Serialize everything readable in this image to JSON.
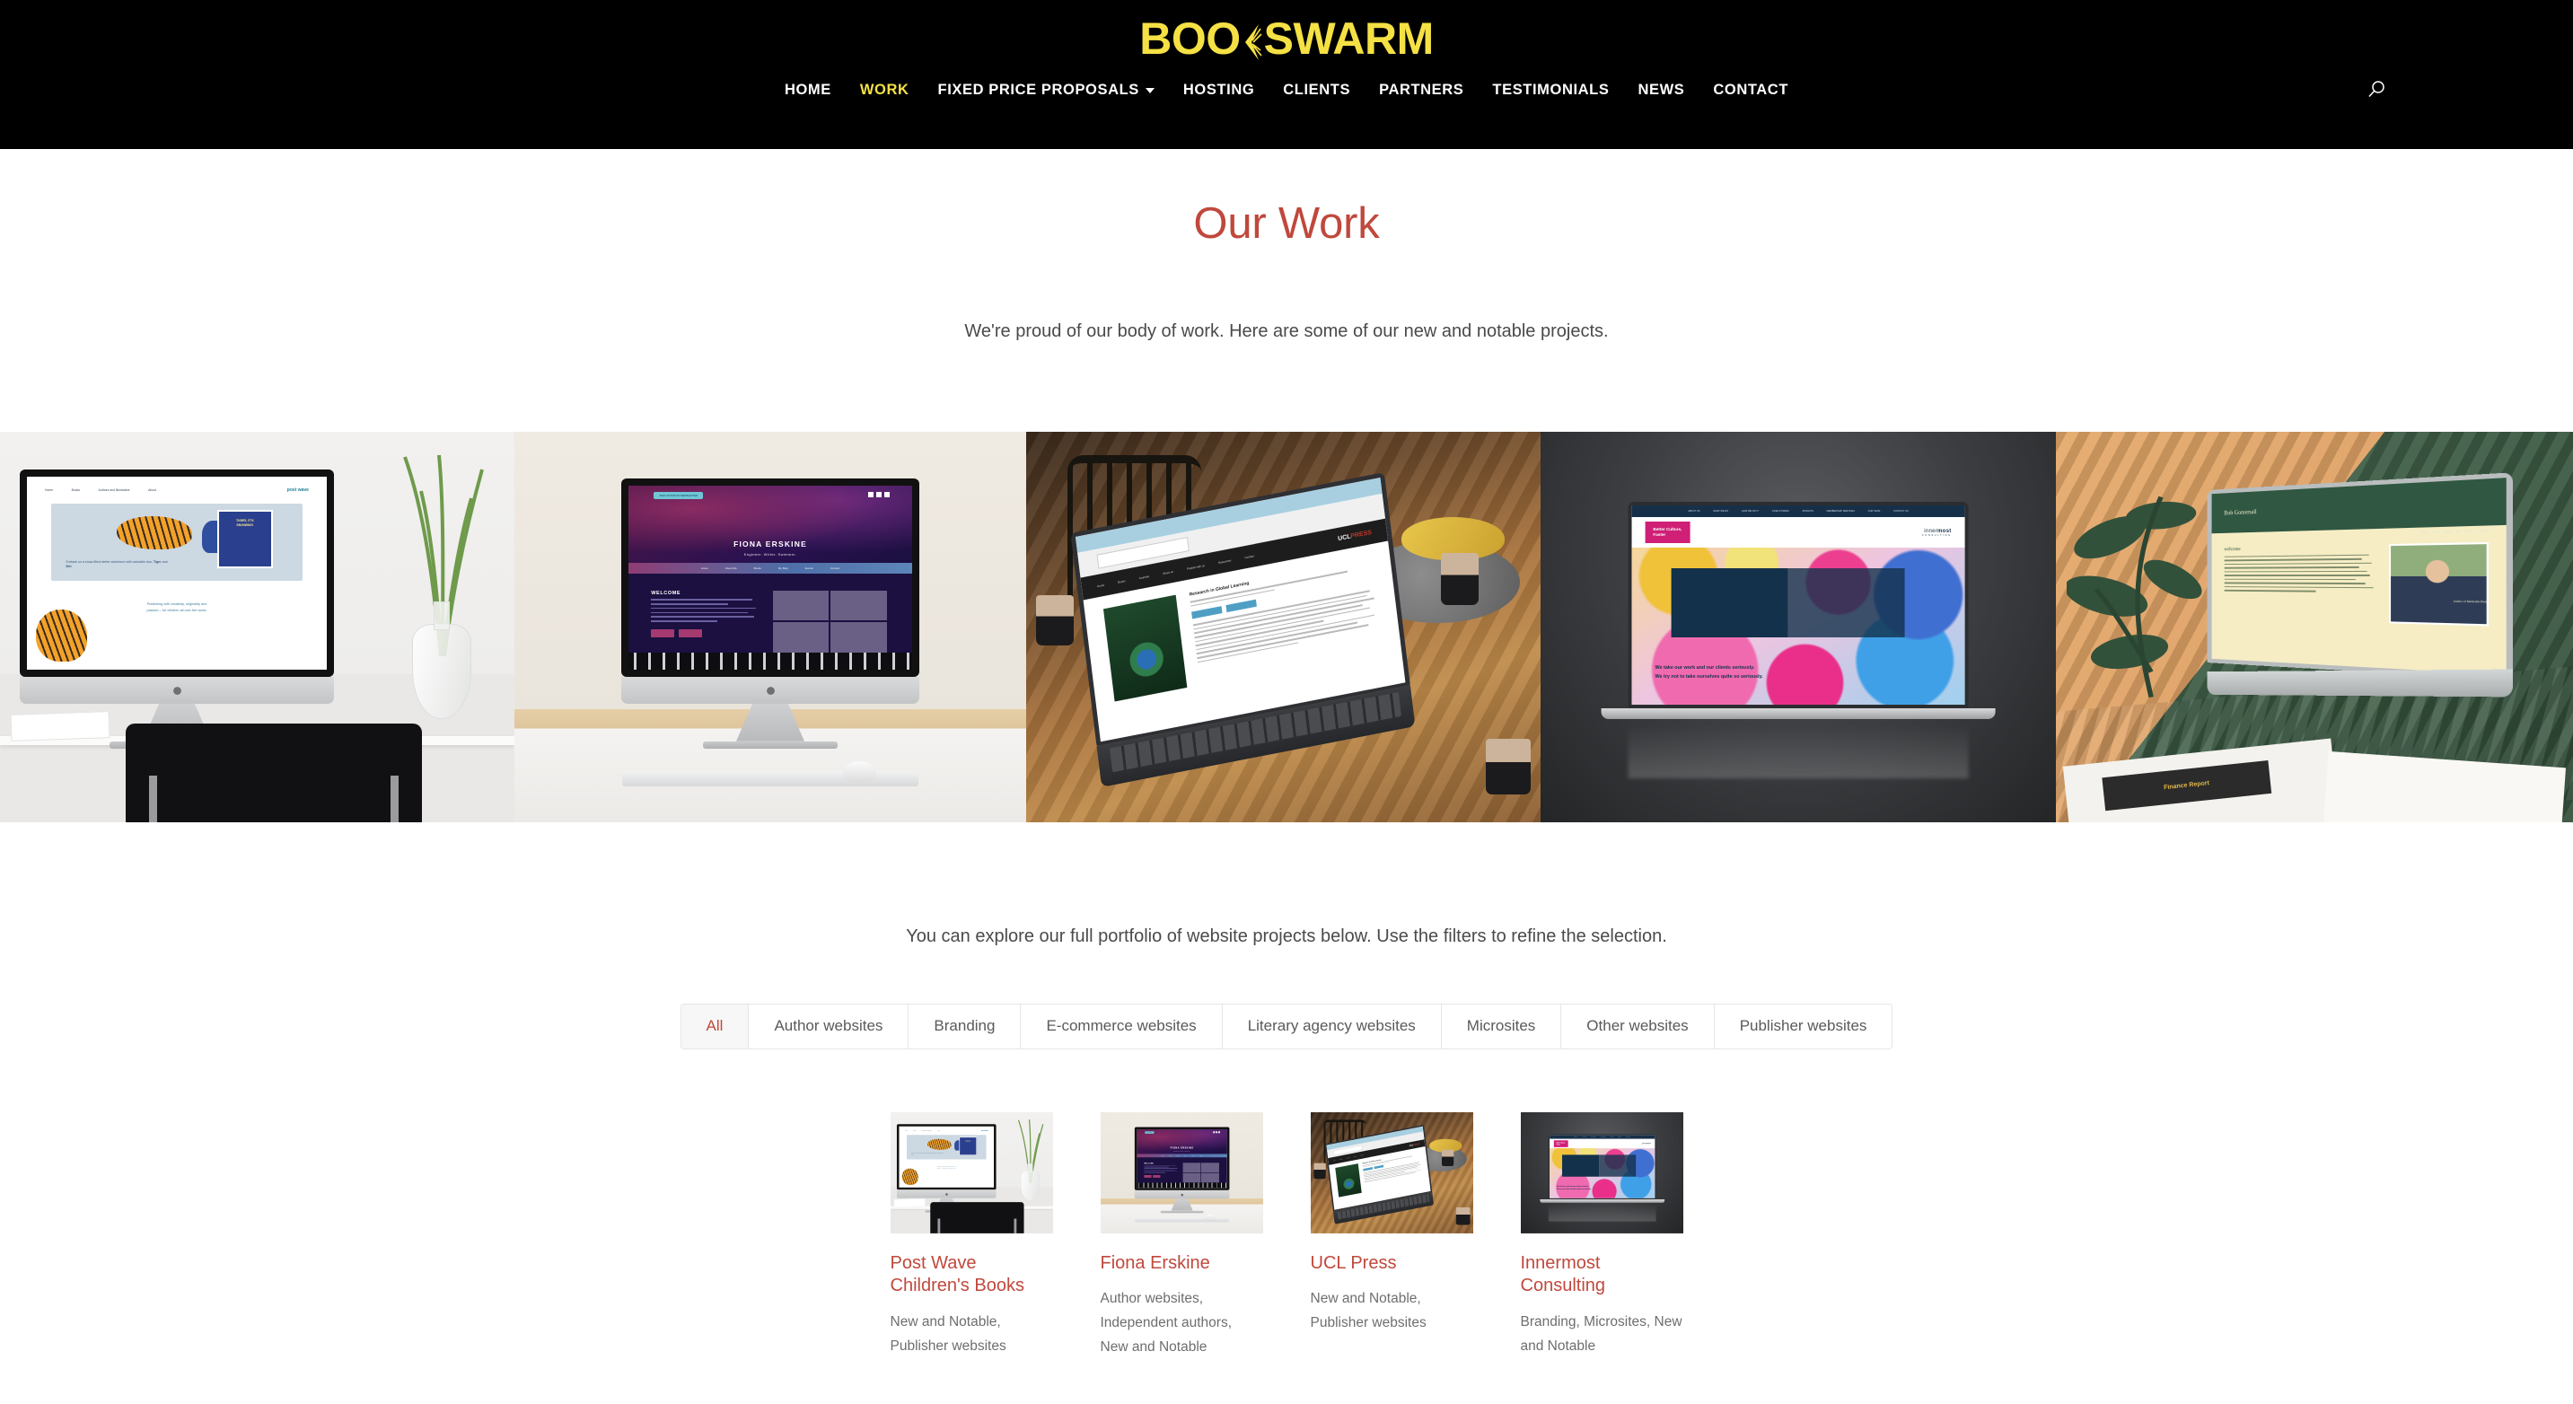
{
  "header": {
    "logo_text_1": "BOO",
    "logo_text_2": "SWARM",
    "logo_alt": "BOOKSWARM",
    "nav": [
      {
        "label": "HOME",
        "active": false,
        "has_dropdown": false
      },
      {
        "label": "WORK",
        "active": true,
        "has_dropdown": false
      },
      {
        "label": "FIXED PRICE PROPOSALS",
        "active": false,
        "has_dropdown": true
      },
      {
        "label": "HOSTING",
        "active": false,
        "has_dropdown": false
      },
      {
        "label": "CLIENTS",
        "active": false,
        "has_dropdown": false
      },
      {
        "label": "PARTNERS",
        "active": false,
        "has_dropdown": false
      },
      {
        "label": "TESTIMONIALS",
        "active": false,
        "has_dropdown": false
      },
      {
        "label": "NEWS",
        "active": false,
        "has_dropdown": false
      },
      {
        "label": "CONTACT",
        "active": false,
        "has_dropdown": false
      }
    ],
    "search_icon": "search-icon",
    "bg_color": "#000000",
    "accent_color": "#f5e144"
  },
  "intro": {
    "title": "Our Work",
    "title_color": "#c0483c",
    "text": "We're proud of our body of work. Here are some of our new and notable projects."
  },
  "hero_strip": {
    "items": [
      {
        "alt": "Post Wave Children's Books website on an iMac",
        "site_name": "post wave",
        "site_tagline": "children's books",
        "hero_copy": "Embark on a snow-filled winter adventure with adorable duo, Tiger and Mei.",
        "book_title": "TIGER, IT'S SNOWING!",
        "strapline": "Publishing with creativity, originality and passion – for children all over the world.",
        "nav": [
          "Home",
          "Books",
          "Authors and Illustrators",
          "About"
        ]
      },
      {
        "alt": "Fiona Erskine website on an iMac",
        "site_name": "FIONA ERSKINE",
        "site_tagline": "Engineer. Writer. Swimmer.",
        "section_heading": "WELCOME",
        "nav": [
          "Home",
          "About Me",
          "Books",
          "My Blog",
          "Events",
          "Contact"
        ]
      },
      {
        "alt": "UCL Press website on a laptop at a cafe table",
        "site_name": "UCL",
        "site_name_2": "PRESS",
        "page_heading": "Research in Global Learning",
        "page_sub": "Methodologies for global citizenship and sustainable development education"
      },
      {
        "alt": "Innermost Consulting website on a laptop",
        "site_name": "innermost",
        "site_tagline": "CONSULTING",
        "tag": "Better Culture, Faster",
        "strapline_1": "We take our work and our clients seriously.",
        "strapline_2": "We try not to take ourselves quite so seriously."
      },
      {
        "alt": "Bob Gomersall website on a laptop",
        "site_name": "Bob Gomersall",
        "site_tagline": "Author of Methodist Heath",
        "section_heading": "welcome",
        "report_label": "Finance Report"
      }
    ]
  },
  "portfolio": {
    "intro": "You can explore our full portfolio of website projects below. Use the filters to refine the selection.",
    "filters": [
      {
        "label": "All",
        "active": true
      },
      {
        "label": "Author websites",
        "active": false
      },
      {
        "label": "Branding",
        "active": false
      },
      {
        "label": "E-commerce websites",
        "active": false
      },
      {
        "label": "Literary agency websites",
        "active": false
      },
      {
        "label": "Microsites",
        "active": false
      },
      {
        "label": "Other websites",
        "active": false
      },
      {
        "label": "Publisher websites",
        "active": false
      }
    ],
    "items": [
      {
        "title": "Post Wave Children's Books",
        "categories": "New and Notable, Publisher websites",
        "thumb_alt": "Post Wave Children's Books website on an iMac"
      },
      {
        "title": "Fiona Erskine",
        "categories": "Author websites, Independent authors, New and Notable",
        "thumb_alt": "Fiona Erskine website on an iMac"
      },
      {
        "title": "UCL Press",
        "categories": "New and Notable, Publisher websites",
        "thumb_alt": "UCL Press website on a laptop"
      },
      {
        "title": "Innermost Consulting",
        "categories": "Branding, Microsites, New and Notable",
        "thumb_alt": "Innermost Consulting website on a laptop"
      }
    ]
  },
  "colors": {
    "brand_yellow": "#f5e144",
    "brand_red": "#c0483c",
    "text_grey": "#4a4a4a",
    "black": "#000000"
  }
}
